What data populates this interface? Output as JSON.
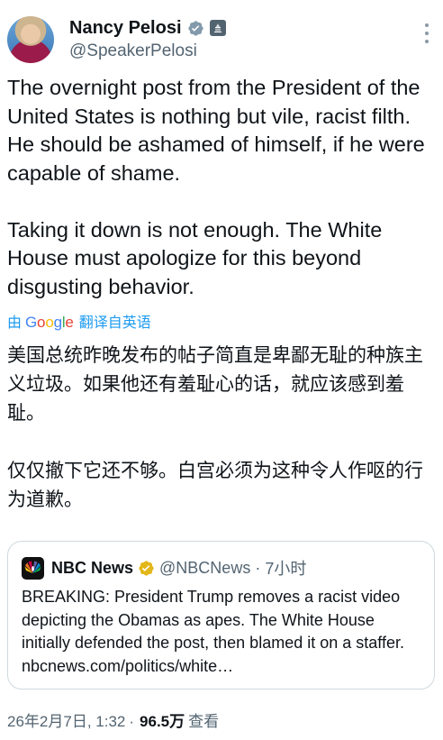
{
  "author": {
    "display_name": "Nancy Pelosi",
    "handle": "@SpeakerPelosi",
    "verified_badge_color": "#829aab",
    "gov_badge_icon": "capitol-icon"
  },
  "tweet": {
    "paragraphs": [
      "The overnight post from the President of the United States is nothing but vile, racist filth. He should be ashamed of himself, if he were capable of shame.",
      "Taking it down is not enough. The White House must apologize for this beyond disgusting behavior."
    ]
  },
  "translation": {
    "prefix": "由",
    "provider": "Google",
    "suffix": "翻译自英语",
    "paragraphs": [
      "美国总统昨晚发布的帖子简直是卑鄙无耻的种族主义垃圾。如果他还有羞耻心的话，就应该感到羞耻。",
      "仅仅撤下它还不够。白宫必须为这种令人作呕的行为道歉。"
    ]
  },
  "quoted_tweet": {
    "display_name": "NBC News",
    "handle": "@NBCNews",
    "separator": "·",
    "time": "7小时",
    "verified_badge_color": "#e2b719",
    "text": "BREAKING: President Trump removes a racist video depicting the Obamas as apes. The White House initially defended the post, then blamed it on a staffer. nbcnews.com/politics/white…"
  },
  "footer": {
    "timestamp": "26年2月7日, 1:32",
    "separator": "·",
    "views": "96.5万",
    "views_label": "查看"
  },
  "colors": {
    "link": "#1d9bf0",
    "secondary_text": "#536471",
    "border": "#cfd9de"
  }
}
